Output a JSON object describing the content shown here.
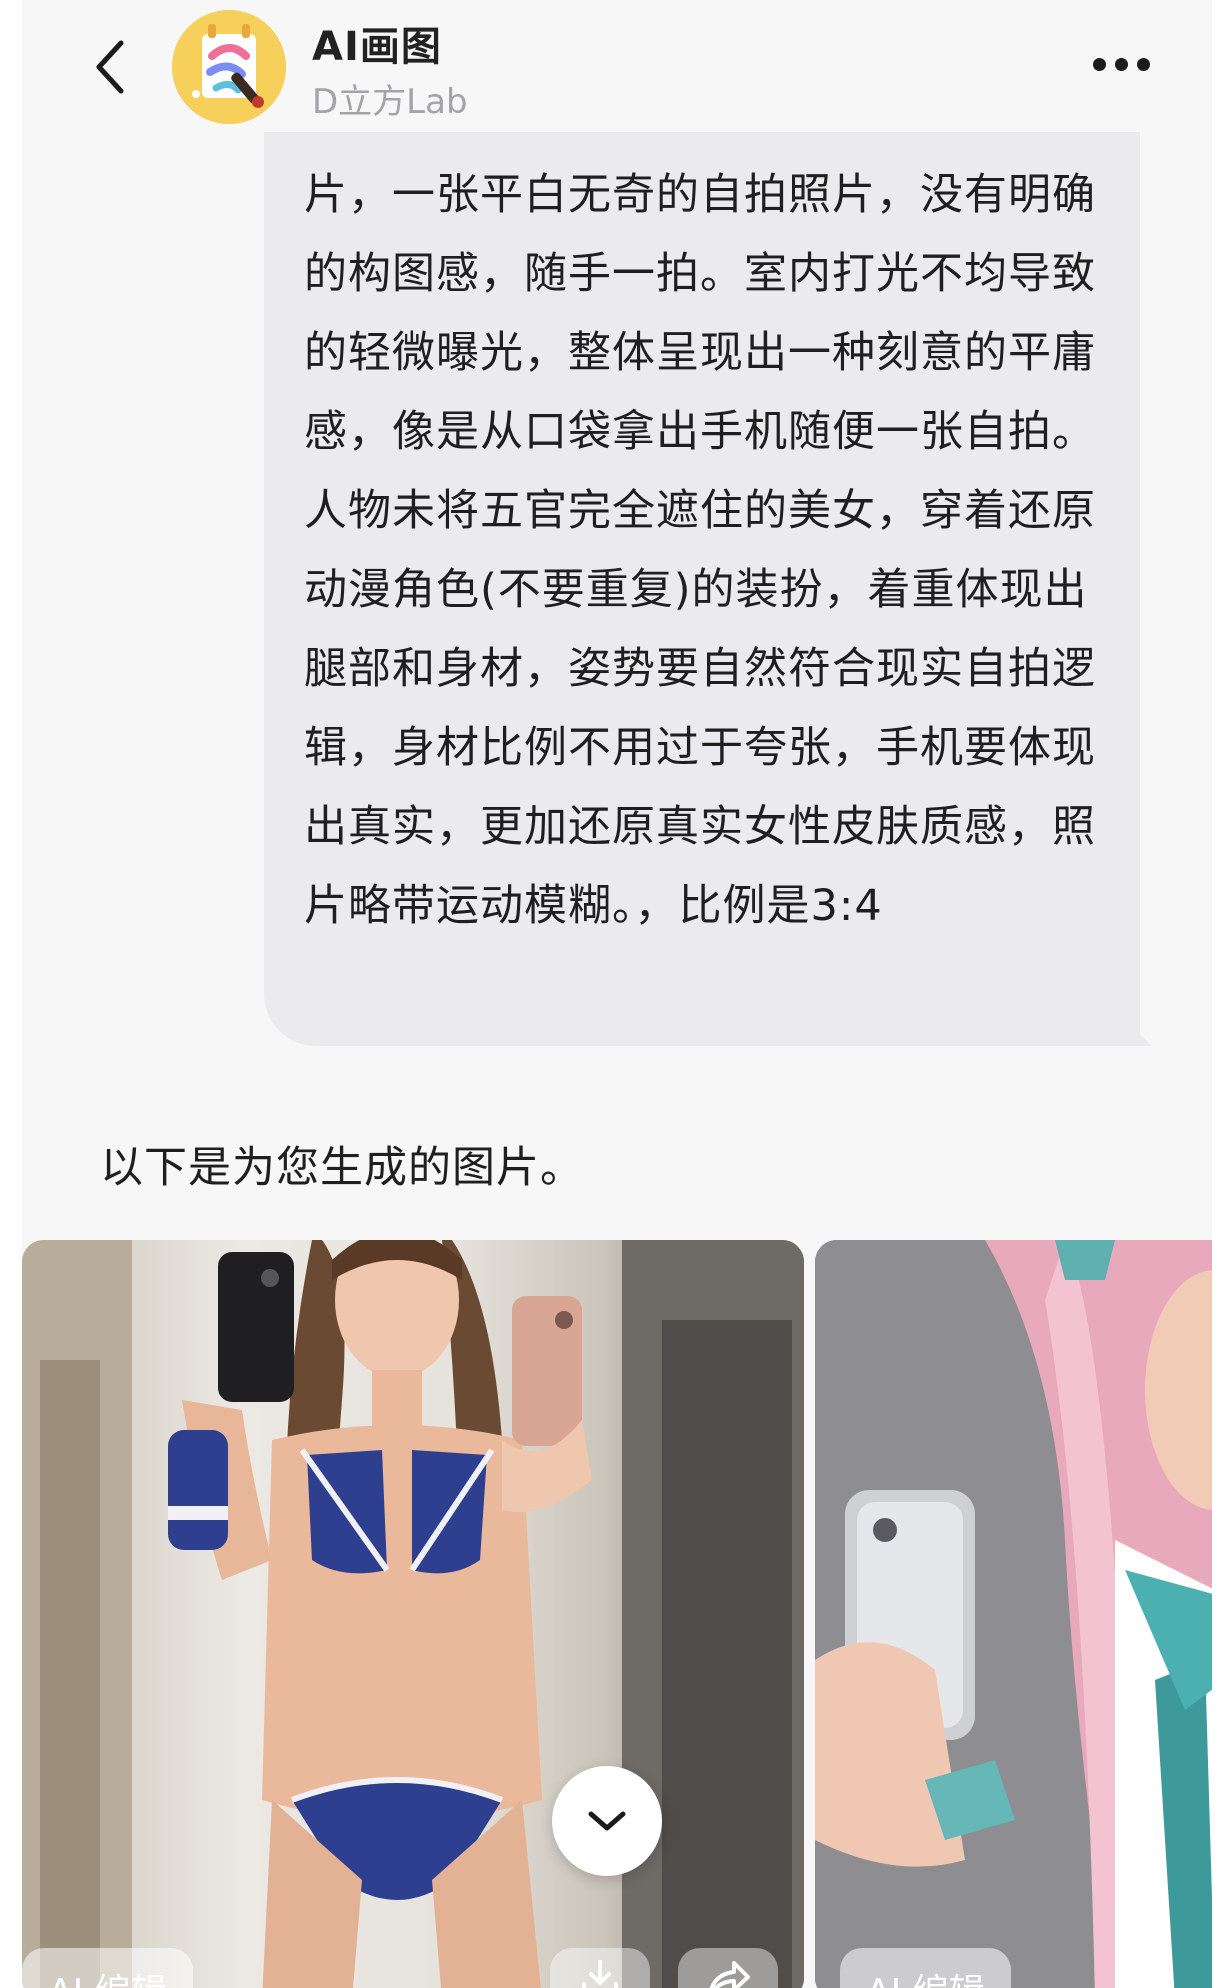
{
  "header": {
    "title": "AI画图",
    "subtitle": "D立方Lab",
    "back_icon": "chevron-left-icon",
    "more_icon": "more-horizontal-icon",
    "avatar_icon": "paint-palette-avatar"
  },
  "user_message": {
    "text": "片，一张平白无奇的自拍照片，没有明确的构图感，随手一拍。室内打光不均导致的轻微曝光，整体呈现出一种刻意的平庸感，像是从口袋拿出手机随便一张自拍。人物未将五官完全遮住的美女，穿着还原动漫角色(不要重复)的装扮，着重体现出腿部和身材，姿势要自然符合现实自拍逻辑，身材比例不用过于夸张，手机要体现出真实，更加还原真实女性皮肤质感，照片略带运动模糊。，比例是3:4"
  },
  "bot_reply": {
    "text": "以下是为您生成的图片。"
  },
  "images": [
    {
      "edit_label": "AI 编辑",
      "download_icon": "download-icon",
      "share_icon": "share-icon"
    },
    {
      "edit_label": "AI 编辑"
    }
  ],
  "scroll_down_icon": "chevron-down-icon",
  "colors": {
    "background": "#f7f7f8",
    "bubble": "#ebebed",
    "subtitle": "#a4a4a8",
    "avatar": "#f6d05a"
  }
}
